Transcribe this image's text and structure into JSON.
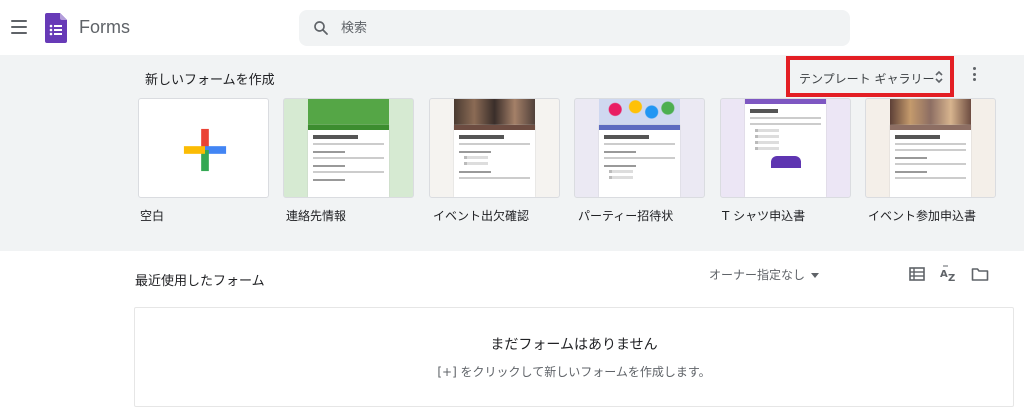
{
  "header": {
    "app_name": "Forms",
    "search_placeholder": "検索"
  },
  "templates": {
    "section_title": "新しいフォームを作成",
    "gallery_label": "テンプレート ギャラリー",
    "items": [
      {
        "label": "空白"
      },
      {
        "label": "連絡先情報"
      },
      {
        "label": "イベント出欠確認"
      },
      {
        "label": "パーティー招待状"
      },
      {
        "label": "T シャツ申込書"
      },
      {
        "label": "イベント参加申込書"
      }
    ]
  },
  "recent": {
    "title": "最近使用したフォーム",
    "owner_filter": "オーナー指定なし",
    "empty_title": "まだフォームはありません",
    "empty_hint": "[+] をクリックして新しいフォームを作成します。"
  },
  "colors": {
    "forms_purple": "#673ab7",
    "highlight_red": "#e31e24",
    "gallery_bg": "#f1f3f4"
  }
}
